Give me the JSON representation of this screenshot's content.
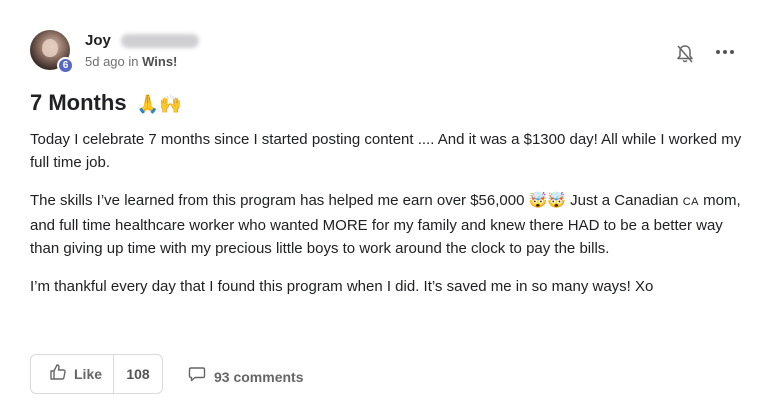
{
  "post": {
    "author": "Joy",
    "level": "6",
    "time_ago": "5d ago in ",
    "category": "Wins!",
    "title": "7 Months",
    "title_emojis": "🙏🙌",
    "paragraphs": [
      [
        "Today I celebrate 7 months since I started posting content .... And it was a $1300 day! All while I worked my full time job."
      ],
      [
        "The skills I’ve learned from this program has helped me earn over $56,000 🤯🤯  Just a Canadian ",
        "CA",
        " mom, and full time healthcare worker who wanted MORE for my family and knew there HAD to be a better way than giving up time with my precious little boys to work around the clock to pay the bills."
      ],
      [
        "I’m thankful every day that I found this program when I did. It’s saved me in so many ways! Xo"
      ]
    ],
    "actions": {
      "like_label": "Like",
      "like_count": "108",
      "comments_label": "93 comments"
    }
  },
  "icons": {
    "notification": "bell-off-icon",
    "menu": "more-horizontal-icon",
    "like": "thumbs-up-icon",
    "comment": "speech-bubble-icon"
  },
  "colors": {
    "level_badge": "#5667c4",
    "muted_text": "#707070",
    "border": "#dadada"
  }
}
